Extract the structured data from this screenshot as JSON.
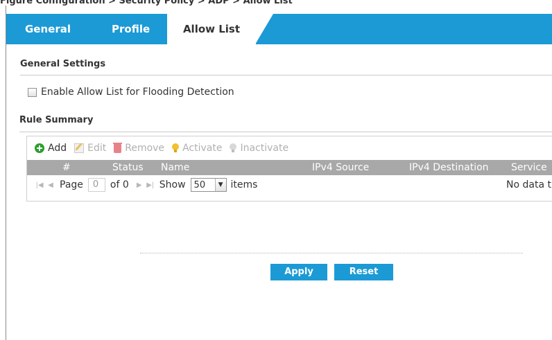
{
  "figure_caption": "Figure  Configuration > Security Policy > ADP > Allow List",
  "tabs": [
    {
      "label": "General"
    },
    {
      "label": "Profile"
    },
    {
      "label": "Allow List"
    }
  ],
  "general_settings": {
    "title": "General Settings",
    "enable_allow_list_label": "Enable Allow List for Flooding Detection",
    "enable_allow_list_checked": false
  },
  "rule_summary": {
    "title": "Rule Summary",
    "toolbar": {
      "add": "Add",
      "edit": "Edit",
      "remove": "Remove",
      "activate": "Activate",
      "inactivate": "Inactivate"
    },
    "columns": [
      "#",
      "Status",
      "Name",
      "IPv4 Source",
      "IPv4 Destination",
      "Service"
    ],
    "rows": [],
    "pager": {
      "page_label": "Page",
      "page_value": "0",
      "of_label": "of 0",
      "show_label": "Show",
      "show_value": "50",
      "items_label": "items",
      "no_data_text": "No data t"
    }
  },
  "buttons": {
    "apply": "Apply",
    "reset": "Reset"
  },
  "colors": {
    "accent": "#1b9ad6",
    "header_gray": "#a8a8a8",
    "add_green": "#2d9e2d",
    "bulb_yellow": "#f3c12e"
  }
}
